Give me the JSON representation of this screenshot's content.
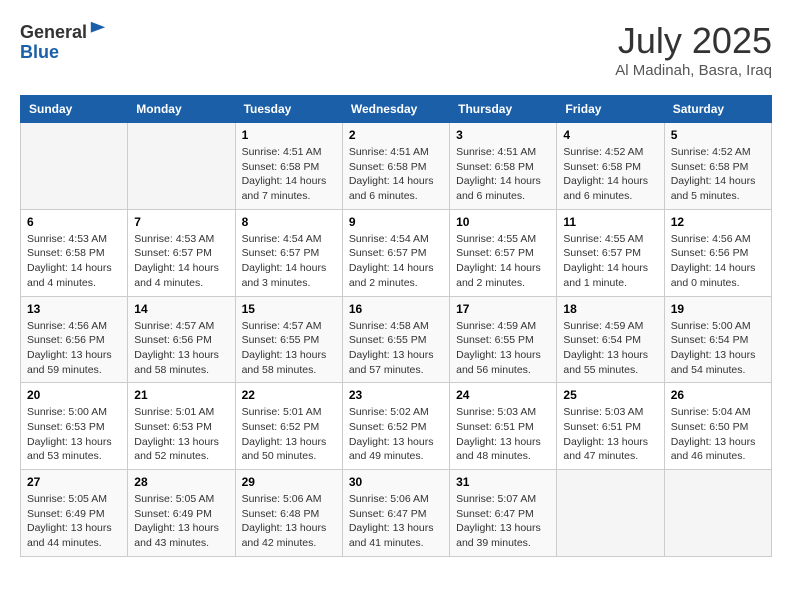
{
  "header": {
    "logo_line1": "General",
    "logo_line2": "Blue",
    "title": "July 2025",
    "subtitle": "Al Madinah, Basra, Iraq"
  },
  "weekdays": [
    "Sunday",
    "Monday",
    "Tuesday",
    "Wednesday",
    "Thursday",
    "Friday",
    "Saturday"
  ],
  "weeks": [
    [
      {
        "day": "",
        "sunrise": "",
        "sunset": "",
        "daylight": ""
      },
      {
        "day": "",
        "sunrise": "",
        "sunset": "",
        "daylight": ""
      },
      {
        "day": "1",
        "sunrise": "Sunrise: 4:51 AM",
        "sunset": "Sunset: 6:58 PM",
        "daylight": "Daylight: 14 hours and 7 minutes."
      },
      {
        "day": "2",
        "sunrise": "Sunrise: 4:51 AM",
        "sunset": "Sunset: 6:58 PM",
        "daylight": "Daylight: 14 hours and 6 minutes."
      },
      {
        "day": "3",
        "sunrise": "Sunrise: 4:51 AM",
        "sunset": "Sunset: 6:58 PM",
        "daylight": "Daylight: 14 hours and 6 minutes."
      },
      {
        "day": "4",
        "sunrise": "Sunrise: 4:52 AM",
        "sunset": "Sunset: 6:58 PM",
        "daylight": "Daylight: 14 hours and 6 minutes."
      },
      {
        "day": "5",
        "sunrise": "Sunrise: 4:52 AM",
        "sunset": "Sunset: 6:58 PM",
        "daylight": "Daylight: 14 hours and 5 minutes."
      }
    ],
    [
      {
        "day": "6",
        "sunrise": "Sunrise: 4:53 AM",
        "sunset": "Sunset: 6:58 PM",
        "daylight": "Daylight: 14 hours and 4 minutes."
      },
      {
        "day": "7",
        "sunrise": "Sunrise: 4:53 AM",
        "sunset": "Sunset: 6:57 PM",
        "daylight": "Daylight: 14 hours and 4 minutes."
      },
      {
        "day": "8",
        "sunrise": "Sunrise: 4:54 AM",
        "sunset": "Sunset: 6:57 PM",
        "daylight": "Daylight: 14 hours and 3 minutes."
      },
      {
        "day": "9",
        "sunrise": "Sunrise: 4:54 AM",
        "sunset": "Sunset: 6:57 PM",
        "daylight": "Daylight: 14 hours and 2 minutes."
      },
      {
        "day": "10",
        "sunrise": "Sunrise: 4:55 AM",
        "sunset": "Sunset: 6:57 PM",
        "daylight": "Daylight: 14 hours and 2 minutes."
      },
      {
        "day": "11",
        "sunrise": "Sunrise: 4:55 AM",
        "sunset": "Sunset: 6:57 PM",
        "daylight": "Daylight: 14 hours and 1 minute."
      },
      {
        "day": "12",
        "sunrise": "Sunrise: 4:56 AM",
        "sunset": "Sunset: 6:56 PM",
        "daylight": "Daylight: 14 hours and 0 minutes."
      }
    ],
    [
      {
        "day": "13",
        "sunrise": "Sunrise: 4:56 AM",
        "sunset": "Sunset: 6:56 PM",
        "daylight": "Daylight: 13 hours and 59 minutes."
      },
      {
        "day": "14",
        "sunrise": "Sunrise: 4:57 AM",
        "sunset": "Sunset: 6:56 PM",
        "daylight": "Daylight: 13 hours and 58 minutes."
      },
      {
        "day": "15",
        "sunrise": "Sunrise: 4:57 AM",
        "sunset": "Sunset: 6:55 PM",
        "daylight": "Daylight: 13 hours and 58 minutes."
      },
      {
        "day": "16",
        "sunrise": "Sunrise: 4:58 AM",
        "sunset": "Sunset: 6:55 PM",
        "daylight": "Daylight: 13 hours and 57 minutes."
      },
      {
        "day": "17",
        "sunrise": "Sunrise: 4:59 AM",
        "sunset": "Sunset: 6:55 PM",
        "daylight": "Daylight: 13 hours and 56 minutes."
      },
      {
        "day": "18",
        "sunrise": "Sunrise: 4:59 AM",
        "sunset": "Sunset: 6:54 PM",
        "daylight": "Daylight: 13 hours and 55 minutes."
      },
      {
        "day": "19",
        "sunrise": "Sunrise: 5:00 AM",
        "sunset": "Sunset: 6:54 PM",
        "daylight": "Daylight: 13 hours and 54 minutes."
      }
    ],
    [
      {
        "day": "20",
        "sunrise": "Sunrise: 5:00 AM",
        "sunset": "Sunset: 6:53 PM",
        "daylight": "Daylight: 13 hours and 53 minutes."
      },
      {
        "day": "21",
        "sunrise": "Sunrise: 5:01 AM",
        "sunset": "Sunset: 6:53 PM",
        "daylight": "Daylight: 13 hours and 52 minutes."
      },
      {
        "day": "22",
        "sunrise": "Sunrise: 5:01 AM",
        "sunset": "Sunset: 6:52 PM",
        "daylight": "Daylight: 13 hours and 50 minutes."
      },
      {
        "day": "23",
        "sunrise": "Sunrise: 5:02 AM",
        "sunset": "Sunset: 6:52 PM",
        "daylight": "Daylight: 13 hours and 49 minutes."
      },
      {
        "day": "24",
        "sunrise": "Sunrise: 5:03 AM",
        "sunset": "Sunset: 6:51 PM",
        "daylight": "Daylight: 13 hours and 48 minutes."
      },
      {
        "day": "25",
        "sunrise": "Sunrise: 5:03 AM",
        "sunset": "Sunset: 6:51 PM",
        "daylight": "Daylight: 13 hours and 47 minutes."
      },
      {
        "day": "26",
        "sunrise": "Sunrise: 5:04 AM",
        "sunset": "Sunset: 6:50 PM",
        "daylight": "Daylight: 13 hours and 46 minutes."
      }
    ],
    [
      {
        "day": "27",
        "sunrise": "Sunrise: 5:05 AM",
        "sunset": "Sunset: 6:49 PM",
        "daylight": "Daylight: 13 hours and 44 minutes."
      },
      {
        "day": "28",
        "sunrise": "Sunrise: 5:05 AM",
        "sunset": "Sunset: 6:49 PM",
        "daylight": "Daylight: 13 hours and 43 minutes."
      },
      {
        "day": "29",
        "sunrise": "Sunrise: 5:06 AM",
        "sunset": "Sunset: 6:48 PM",
        "daylight": "Daylight: 13 hours and 42 minutes."
      },
      {
        "day": "30",
        "sunrise": "Sunrise: 5:06 AM",
        "sunset": "Sunset: 6:47 PM",
        "daylight": "Daylight: 13 hours and 41 minutes."
      },
      {
        "day": "31",
        "sunrise": "Sunrise: 5:07 AM",
        "sunset": "Sunset: 6:47 PM",
        "daylight": "Daylight: 13 hours and 39 minutes."
      },
      {
        "day": "",
        "sunrise": "",
        "sunset": "",
        "daylight": ""
      },
      {
        "day": "",
        "sunrise": "",
        "sunset": "",
        "daylight": ""
      }
    ]
  ]
}
